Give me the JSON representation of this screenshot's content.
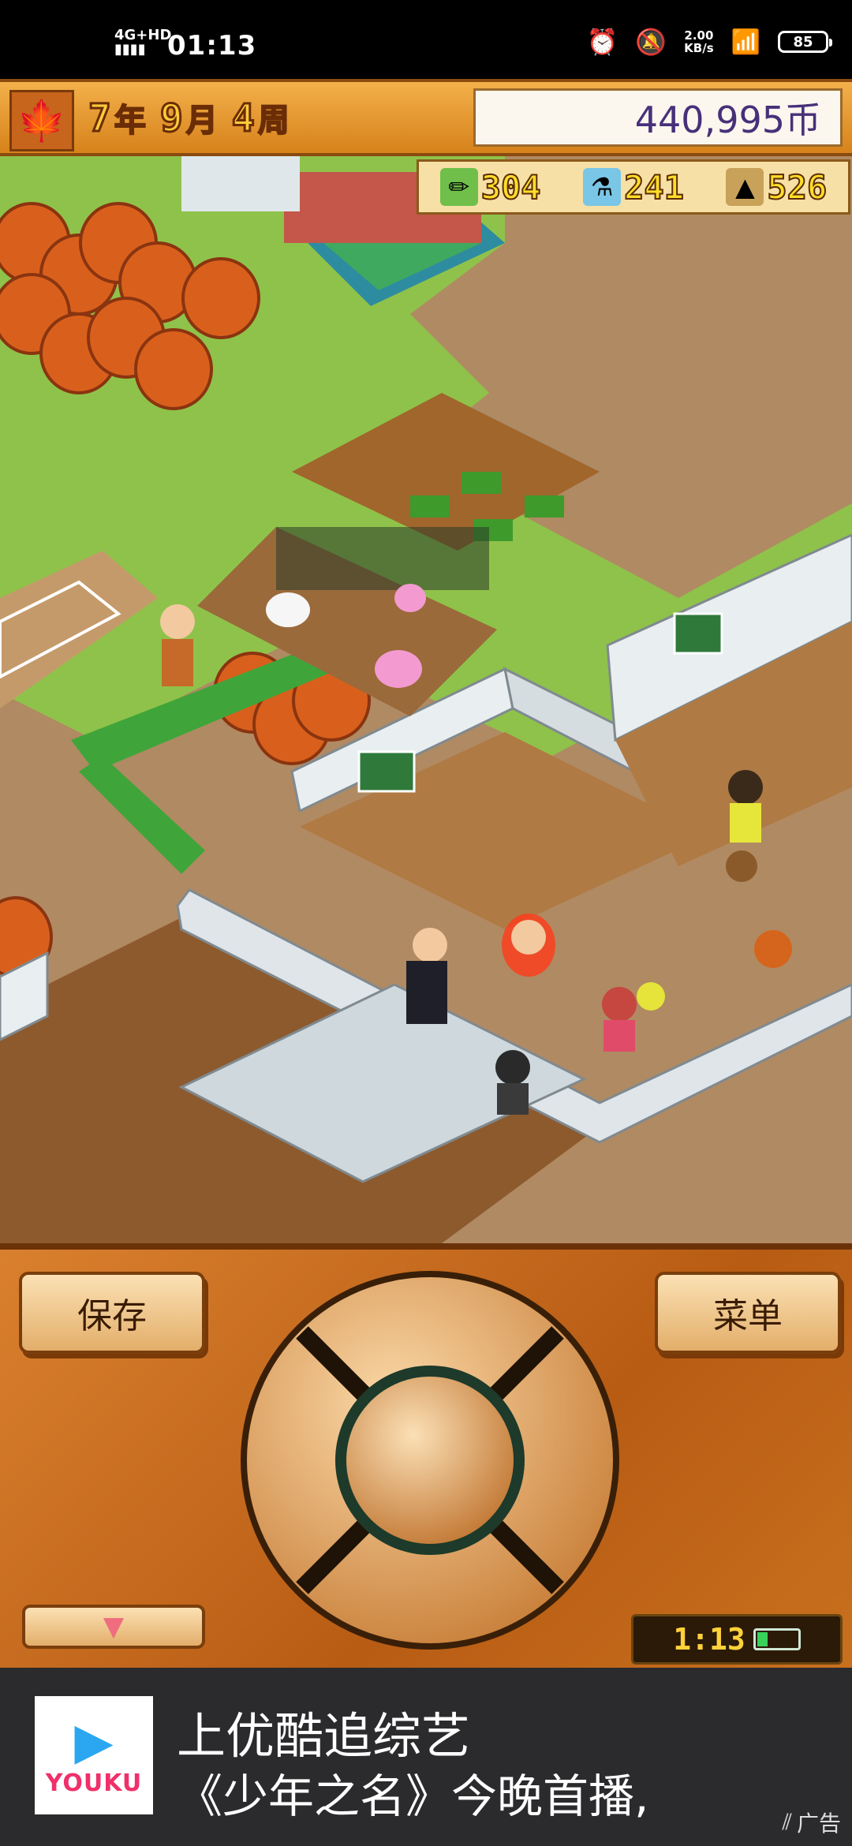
{
  "status_bar": {
    "network": "4G+HD",
    "time": "01:13",
    "speed_value": "2.00",
    "speed_unit": "KB/s",
    "battery": "85"
  },
  "header": {
    "season_icon": "maple-leaf-icon",
    "year": "7",
    "year_unit": "年",
    "month": "9",
    "month_unit": "月",
    "week": "4",
    "week_unit": "周",
    "money": "440,995币"
  },
  "resources": [
    {
      "icon": "pencil-icon",
      "value": "304"
    },
    {
      "icon": "flask-icon",
      "value": "241"
    },
    {
      "icon": "pyramid-icon",
      "value": "526"
    }
  ],
  "controller": {
    "save_label": "保存",
    "menu_label": "菜单",
    "clock": "1:13",
    "battery_level": 0.25
  },
  "ad": {
    "logo_text": "YOUKU",
    "line1": "上优酷追综艺",
    "line2": "《少年之名》今晚首播,",
    "tag": "广告"
  },
  "colors": {
    "panel_orange": "#c8701e",
    "money_text": "#47307a",
    "resource_text": "#ffde2a"
  }
}
